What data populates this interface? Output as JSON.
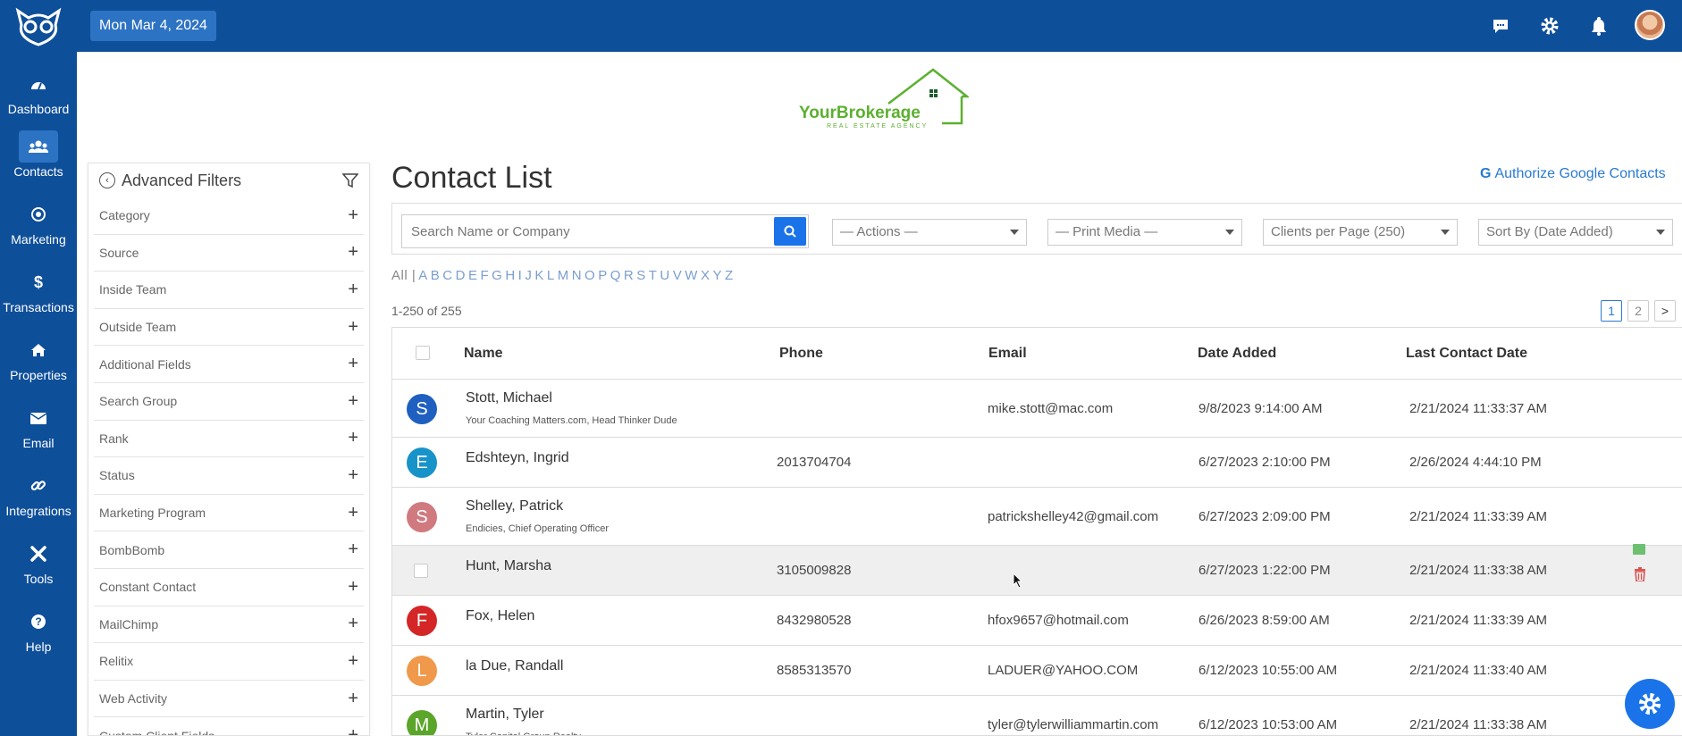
{
  "topbar": {
    "date": "Mon Mar 4, 2024"
  },
  "nav": [
    {
      "label": "Dashboard",
      "icon": "dashboard-icon"
    },
    {
      "label": "Contacts",
      "icon": "contacts-icon",
      "active": true
    },
    {
      "label": "Marketing",
      "icon": "marketing-icon"
    },
    {
      "label": "Transactions",
      "icon": "dollar-icon"
    },
    {
      "label": "Properties",
      "icon": "home-icon"
    },
    {
      "label": "Email",
      "icon": "envelope-icon"
    },
    {
      "label": "Integrations",
      "icon": "link-icon"
    },
    {
      "label": "Tools",
      "icon": "tools-icon"
    },
    {
      "label": "Help",
      "icon": "help-icon"
    }
  ],
  "brand": {
    "name": "YourBrokerage",
    "tagline": "REAL ESTATE AGENCY",
    "color": "#5cb030"
  },
  "filters": {
    "title": "Advanced Filters",
    "items": [
      "Category",
      "Source",
      "Inside Team",
      "Outside Team",
      "Additional Fields",
      "Search Group",
      "Rank",
      "Status",
      "Marketing Program",
      "BombBomb",
      "Constant Contact",
      "MailChimp",
      "Relitix",
      "Web Activity",
      "Custom Client Fields"
    ]
  },
  "page": {
    "title": "Contact List",
    "google_link": "Authorize Google Contacts"
  },
  "toolbar": {
    "search_placeholder": "Search Name or Company",
    "actions": "— Actions —",
    "print_media": "— Print Media —",
    "per_page": "Clients per Page (250)",
    "sort": "Sort By (Date Added)"
  },
  "alphabet": [
    "All |",
    "A",
    "B",
    "C",
    "D",
    "E",
    "F",
    "G",
    "H",
    "I",
    "J",
    "K",
    "L",
    "M",
    "N",
    "O",
    "P",
    "Q",
    "R",
    "S",
    "T",
    "U",
    "V",
    "W",
    "X",
    "Y",
    "Z"
  ],
  "range_text": "1-250 of 255",
  "pagination": {
    "pages": [
      "1",
      "2"
    ],
    "current": "1",
    "next": ">"
  },
  "table": {
    "headers": {
      "name": "Name",
      "phone": "Phone",
      "email": "Email",
      "date_added": "Date Added",
      "last_contact": "Last Contact Date"
    },
    "rows": [
      {
        "initial": "S",
        "color": "#1f5fbf",
        "name": "Stott, Michael",
        "sub": "Your Coaching Matters.com, Head Thinker Dude",
        "phone": "",
        "email": "mike.stott@mac.com",
        "date_added": "9/8/2023 9:14:00 AM",
        "last_contact": "2/21/2024 11:33:37 AM"
      },
      {
        "initial": "E",
        "color": "#1793c9",
        "name": "Edshteyn, Ingrid",
        "sub": "",
        "phone": "2013704704",
        "email": "",
        "date_added": "6/27/2023 2:10:00 PM",
        "last_contact": "2/26/2024 4:44:10 PM"
      },
      {
        "initial": "S",
        "color": "#d07a80",
        "name": "Shelley, Patrick",
        "sub": "Endicies, Chief Operating Officer",
        "phone": "",
        "email": "patrickshelley42@gmail.com",
        "date_added": "6/27/2023 2:09:00 PM",
        "last_contact": "2/21/2024 11:33:39 AM"
      },
      {
        "initial": "",
        "color": "",
        "name": "Hunt, Marsha",
        "sub": "",
        "phone": "3105009828",
        "email": "",
        "date_added": "6/27/2023 1:22:00 PM",
        "last_contact": "2/21/2024 11:33:38 AM",
        "hover": true
      },
      {
        "initial": "F",
        "color": "#d42626",
        "name": "Fox, Helen",
        "sub": "",
        "phone": "8432980528",
        "email": "hfox9657@hotmail.com",
        "date_added": "6/26/2023 8:59:00 AM",
        "last_contact": "2/21/2024 11:33:39 AM"
      },
      {
        "initial": "L",
        "color": "#f0994a",
        "name": "la Due, Randall",
        "sub": "",
        "phone": "8585313570",
        "email": "LADUER@YAHOO.COM",
        "date_added": "6/12/2023 10:55:00 AM",
        "last_contact": "2/21/2024 11:33:40 AM"
      },
      {
        "initial": "M",
        "color": "#5aa52a",
        "name": "Martin, Tyler",
        "sub": "Tyler Capital Group Realty",
        "phone": "",
        "email": "tyler@tylerwilliammartin.com",
        "date_added": "6/12/2023 10:53:00 AM",
        "last_contact": "2/21/2024 11:33:38 AM"
      }
    ]
  }
}
